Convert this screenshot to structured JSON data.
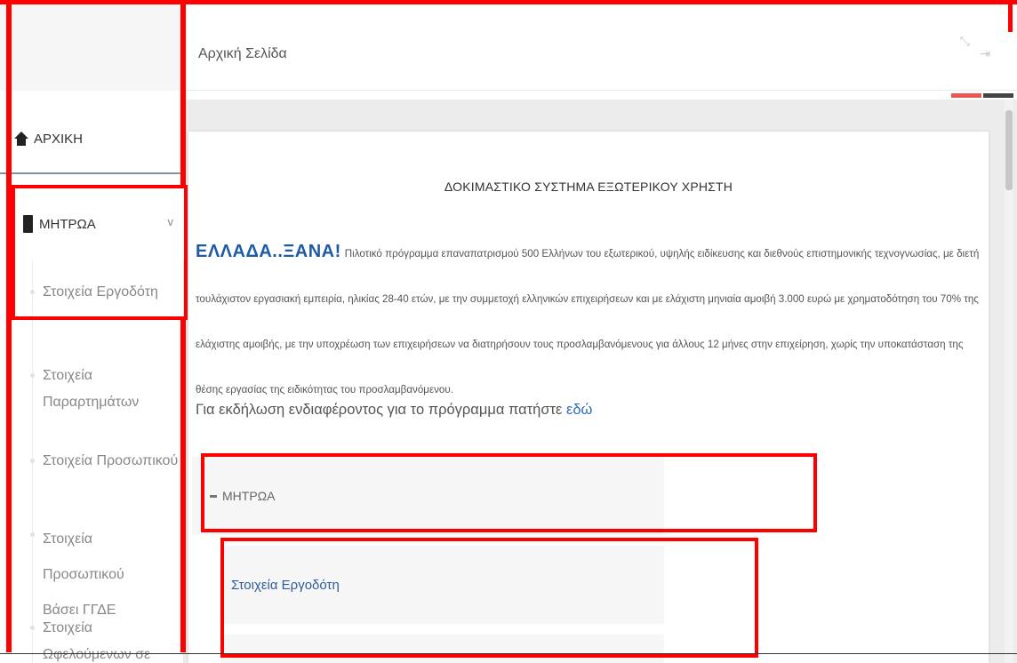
{
  "sidebar": {
    "home_label": "ΑΡΧΙΚΗ",
    "registry_label": "ΜΗΤΡΩΑ",
    "registry_chevron": "v",
    "sub_items": [
      "Στοιχεία Εργοδότη",
      "Στοιχεία Παραρτημάτων",
      "Στοιχεία Προσωπικού",
      "Στοιχεία Προσωπικού Βάσει ΓΓΔΕ",
      "Στοιχεία Ωφελούμενων σε"
    ]
  },
  "header": {
    "page_title": "Αρχική Σελίδα",
    "accent_colors": [
      "#e85a4f",
      "#444444"
    ]
  },
  "card": {
    "title": "ΔΟΚΙΜΑΣΤΙΚΟ ΣΥΣΤΗΜΑ ΕΞΩΤΕΡΙΚΟΥ ΧΡΗΣΤΗ",
    "intro_highlight": "ΕΛΛΑΔΑ..ΞΑΝΑ!",
    "intro_text": "Πιλοτικό πρόγραμμα επαναπατρισμού 500 Ελλήνων του εξωτερικού, υψηλής ειδίκευσης και διεθνούς επιστημονικής τεχνογνωσίας, με διετή τουλάχιστον εργασιακή εμπειρία, ηλικίας 28-40 ετών, με την συμμετοχή ελληνικών επιχειρήσεων και με ελάχιστη μηνιαία αμοιβή 3.000 ευρώ με χρηματοδότηση του 70% της ελάχιστης αμοιβής, με την υποχρέωση των επιχειρήσεων να διατηρήσουν τους προσλαμβανόμενους για άλλους 12 μήνες στην επιχείρηση, χωρίς την υποκατάσταση της θέσης εργασίας της ειδικότητας του προσλαμβανόμενου.",
    "interest_text": "Για εκδήλωση ενδιαφέροντος για το πρόγραμμα πατήστε",
    "interest_link": "εδώ",
    "registry_panel_label": "ΜΗΤΡΩΑ",
    "employer_link": "Στοιχεία Εργοδότη"
  },
  "annotation_color": "#ff0000"
}
